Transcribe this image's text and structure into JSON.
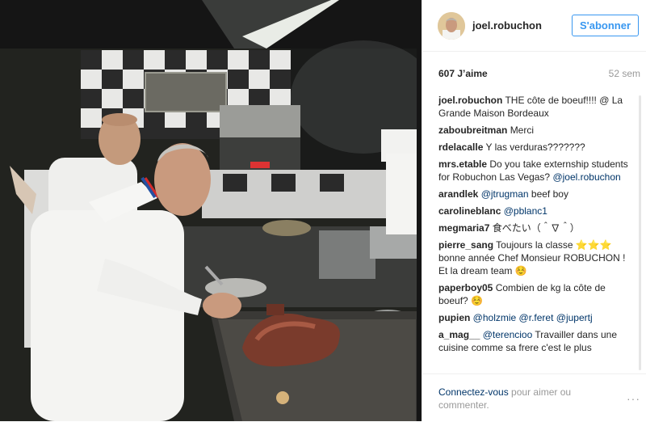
{
  "photo": {
    "alt": ""
  },
  "header": {
    "username": "joel.robuchon",
    "follow_label": "S'abonner"
  },
  "post": {
    "likes": "607 J’aime",
    "age": "52 sem"
  },
  "comments": [
    {
      "user": "joel.robuchon",
      "parts": [
        {
          "t": "THE côte de boeuf!!!! @ La Grande Maison Bordeaux"
        }
      ]
    },
    {
      "user": "zaboubreitman",
      "parts": [
        {
          "t": "Merci"
        }
      ]
    },
    {
      "user": "rdelacalle",
      "parts": [
        {
          "t": "Y las verduras???????"
        }
      ]
    },
    {
      "user": "mrs.etable",
      "parts": [
        {
          "t": "Do you take externship students for Robuchon Las Vegas? "
        },
        {
          "m": "@joel.robuchon"
        }
      ]
    },
    {
      "user": "arandlek",
      "parts": [
        {
          "m": "@jtrugman"
        },
        {
          "t": " beef boy"
        }
      ]
    },
    {
      "user": "carolineblanc",
      "parts": [
        {
          "m": "@pblanc1"
        }
      ]
    },
    {
      "user": "megmaria7",
      "parts": [
        {
          "t": "食べたい（＾∇＾）"
        }
      ]
    },
    {
      "user": "pierre_sang",
      "parts": [
        {
          "t": "Toujours la classe ⭐️⭐️⭐️ bonne année Chef Monsieur ROBUCHON ! Et la dream team ☺️"
        }
      ]
    },
    {
      "user": "paperboy05",
      "parts": [
        {
          "t": "Combien de kg la côte de boeuf? ☺️"
        }
      ]
    },
    {
      "user": "pupien",
      "parts": [
        {
          "m": "@holzmie"
        },
        {
          "t": " "
        },
        {
          "m": "@r.feret"
        },
        {
          "t": " "
        },
        {
          "m": "@jupertj"
        }
      ]
    },
    {
      "user": "a_mag__",
      "parts": [
        {
          "m": "@terencioo"
        },
        {
          "t": " Travailler dans une cuisine comme sa frere c'est le plus"
        }
      ]
    }
  ],
  "footer": {
    "login_link": "Connectez-vous",
    "login_rest": " pour aimer ou commenter.",
    "more": "···"
  },
  "colors": {
    "accent": "#3897f0",
    "mention": "#003569",
    "muted": "#999999"
  }
}
